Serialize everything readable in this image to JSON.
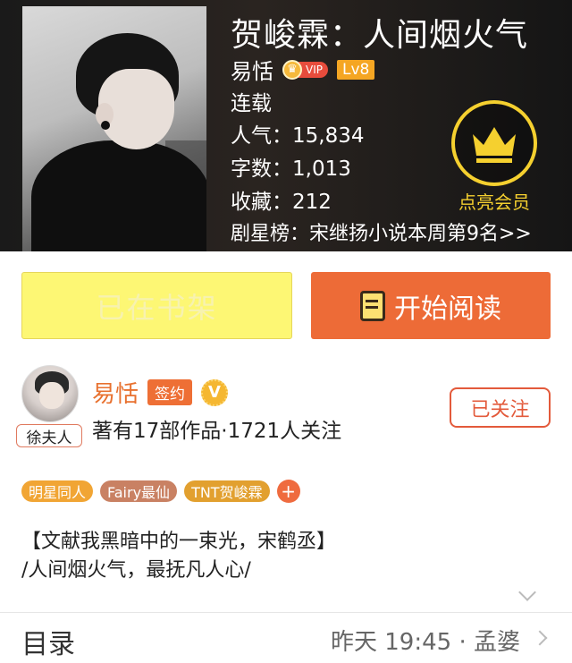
{
  "book": {
    "title": "贺峻霖：人间烟火气",
    "author": "易恬",
    "vip_label": "VIP",
    "vip_icon": "crown-icon",
    "level": "Lv8",
    "status": "连载",
    "popularity": "人气：15,834",
    "word_count": "字数：1,013",
    "favorites": "收藏：212",
    "rank": "剧星榜：宋继扬小说本周第9名>>",
    "member_label": "点亮会员"
  },
  "actions": {
    "shelf_label": "已在书架",
    "read_label": "开始阅读"
  },
  "author_card": {
    "avatar_tag": "徐夫人",
    "name": "易恬",
    "sign_label": "签约",
    "verified_label": "V",
    "meta": "著有17部作品·1721人关注",
    "follow_label": "已关注"
  },
  "tags": [
    {
      "label": "明星同人",
      "color": "#f1a534"
    },
    {
      "label": "Fairy最仙",
      "color": "#c98163"
    },
    {
      "label": "TNT贺峻霖",
      "color": "#e2a02f"
    }
  ],
  "description": {
    "line1": "【文献我黑暗中的一束光，宋鹤丞】",
    "line2": "/人间烟火气，最抚凡人心/"
  },
  "toc": {
    "label": "目录",
    "update": "昨天 19:45 · 孟婆"
  },
  "colors": {
    "accent": "#ed6b37",
    "gold": "#f5d02f",
    "shelf_bg": "#fdf774"
  }
}
